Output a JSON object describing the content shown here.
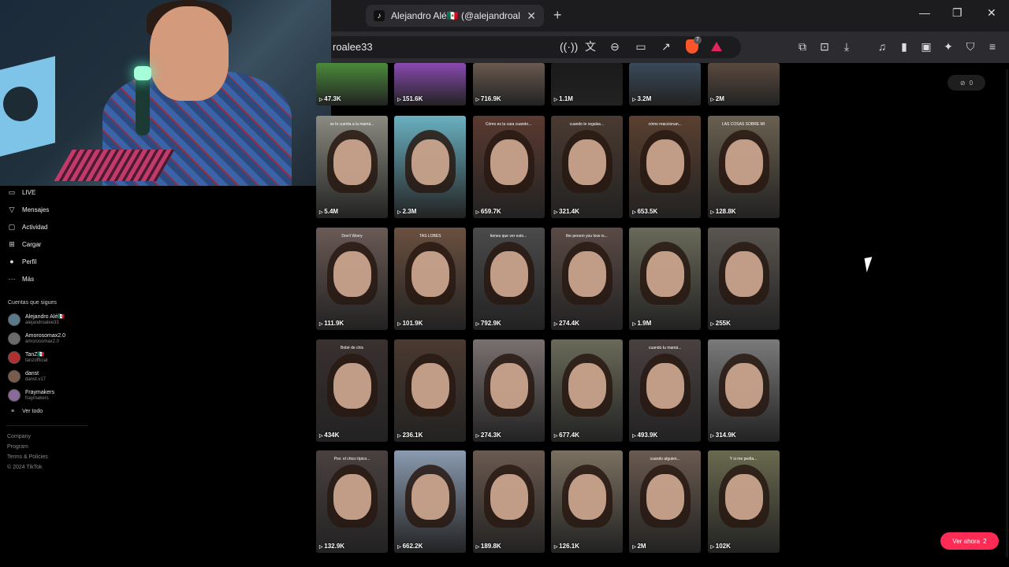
{
  "browser": {
    "tab_title": "Alejandro Alé🇲🇽 (@alejandroale",
    "url": "roalee33",
    "new_tab": "+",
    "window_controls": {
      "minimize": "—",
      "maximize": "❐",
      "close": "✕"
    }
  },
  "sidebar": {
    "nav": [
      {
        "label": "LIVE",
        "icon": "live-icon"
      },
      {
        "label": "Mensajes",
        "icon": "messages-icon"
      },
      {
        "label": "Actividad",
        "icon": "activity-icon"
      },
      {
        "label": "Cargar",
        "icon": "upload-icon"
      },
      {
        "label": "Perfil",
        "icon": "profile-icon"
      },
      {
        "label": "Más",
        "icon": "more-icon"
      }
    ],
    "following_title": "Cuentas que sigues",
    "following": [
      {
        "name": "Alejandro Alé🇲🇽",
        "handle": "alejandroalee33",
        "color": "#5a7a8a"
      },
      {
        "name": "Amorosomax2.0",
        "handle": "amorosomax2.0",
        "color": "#6a6a6a"
      },
      {
        "name": "TanZ🇲🇽",
        "handle": "tanzofficial",
        "color": "#b03030"
      },
      {
        "name": "danst",
        "handle": "danst.v17",
        "color": "#7a5a4a"
      },
      {
        "name": "Fraymakers",
        "handle": "fraymakers",
        "color": "#8a6a9a"
      }
    ],
    "see_all": "Ver todo",
    "see_all_icon": "≡",
    "footer": [
      "Company",
      "Program",
      "Terms & Policies",
      "© 2024 TikTok"
    ]
  },
  "grid": {
    "rows": [
      [
        {
          "views": "47.3K",
          "bg": "#4a8a3a",
          "caption": ""
        },
        {
          "views": "151.6K",
          "bg": "#8a4ab0",
          "caption": ""
        },
        {
          "views": "716.9K",
          "bg": "#6a5a50",
          "caption": ""
        },
        {
          "views": "1.1M",
          "bg": "#1a1a1a",
          "caption": ""
        },
        {
          "views": "3.2M",
          "bg": "#3a4a5a",
          "caption": ""
        },
        {
          "views": "2M",
          "bg": "#5a4a40",
          "caption": ""
        }
      ],
      [
        {
          "views": "5.4M",
          "bg": "#8a8a80",
          "caption": "se lo cuenta a la mamá..."
        },
        {
          "views": "2.3M",
          "bg": "#6ab0c0",
          "caption": ""
        },
        {
          "views": "659.7K",
          "bg": "#5a3a30",
          "caption": "Cómo es la cara cuando..."
        },
        {
          "views": "321.4K",
          "bg": "#4a3a30",
          "caption": "cuando le regalas..."
        },
        {
          "views": "653.5K",
          "bg": "#5a4030",
          "caption": "cómo reaccionan..."
        },
        {
          "views": "128.8K",
          "bg": "#6a6050",
          "caption": "LAS COSAS SOBRE MI"
        }
      ],
      [
        {
          "views": "111.9K",
          "bg": "#6a5a55",
          "caption": "Don't Worry"
        },
        {
          "views": "101.9K",
          "bg": "#6a5040",
          "caption": "TAS LOBES"
        },
        {
          "views": "792.9K",
          "bg": "#4a4a4a",
          "caption": "tienes que ver esto..."
        },
        {
          "views": "274.4K",
          "bg": "#5a4a45",
          "caption": "the person you love is..."
        },
        {
          "views": "1.9M",
          "bg": "#6a6a5a",
          "caption": ""
        },
        {
          "views": "255K",
          "bg": "#5a5550",
          "caption": ""
        }
      ],
      [
        {
          "views": "434K",
          "bg": "#3a3030",
          "caption": "Bebé de chis"
        },
        {
          "views": "236.1K",
          "bg": "#4a3a30",
          "caption": ""
        },
        {
          "views": "274.3K",
          "bg": "#7a7070",
          "caption": ""
        },
        {
          "views": "677.4K",
          "bg": "#6a6a5a",
          "caption": ""
        },
        {
          "views": "493.9K",
          "bg": "#4a4040",
          "caption": "cuando tu mamá..."
        },
        {
          "views": "314.9K",
          "bg": "#7a7a7a",
          "caption": ""
        }
      ],
      [
        {
          "views": "132.9K",
          "bg": "#4a4040",
          "caption": "Pov: el chico típico..."
        },
        {
          "views": "662.2K",
          "bg": "#8a9ab0",
          "caption": ""
        },
        {
          "views": "189.8K",
          "bg": "#6a5a50",
          "caption": ""
        },
        {
          "views": "126.1K",
          "bg": "#7a7060",
          "caption": ""
        },
        {
          "views": "2M",
          "bg": "#6a5a50",
          "caption": "cuando alguien..."
        },
        {
          "views": "102K",
          "bg": "#6a6a50",
          "caption": "Y si me pedía..."
        }
      ]
    ]
  },
  "right": {
    "toggle_icon": "⊘",
    "toggle_value": "0",
    "watch_now": "Ver ahora",
    "watch_now_count": "2"
  }
}
